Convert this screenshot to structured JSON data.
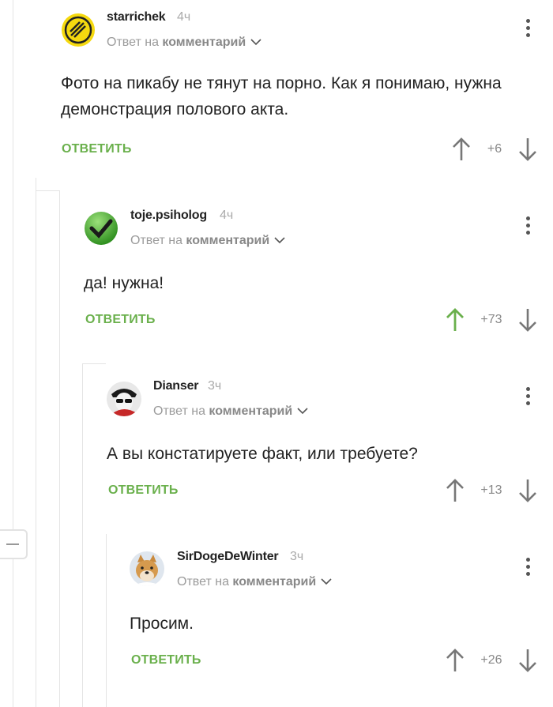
{
  "reply_to_prefix": "Ответ на",
  "reply_to_target": "комментарий",
  "reply_button_label": "ОТВЕТИТЬ",
  "colors": {
    "accent_green": "#6ab04c",
    "upvoted": "#6ab04c",
    "muted": "#9b9b9b"
  },
  "comments": [
    {
      "username": "starrichek",
      "time": "4ч",
      "text": "Фото на пикабу не тянут на порно. Как я понимаю, нужна демонстрация полового акта.",
      "rating": "+6",
      "upvoted": false,
      "avatar_icon": "slashed-circle-logo-icon"
    },
    {
      "username": "toje.psiholog",
      "time": "4ч",
      "text": "да! нужна!",
      "rating": "+73",
      "upvoted": true,
      "avatar_icon": "green-checkmark-icon"
    },
    {
      "username": "Dianser",
      "time": "3ч",
      "text": "А вы констатируете факт, или требуете?",
      "rating": "+13",
      "upvoted": false,
      "avatar_icon": "user-photo-avatar"
    },
    {
      "username": "SirDogeDeWinter",
      "time": "3ч",
      "text": "Просим.",
      "rating": "+26",
      "upvoted": false,
      "avatar_icon": "doge-photo-avatar"
    }
  ]
}
